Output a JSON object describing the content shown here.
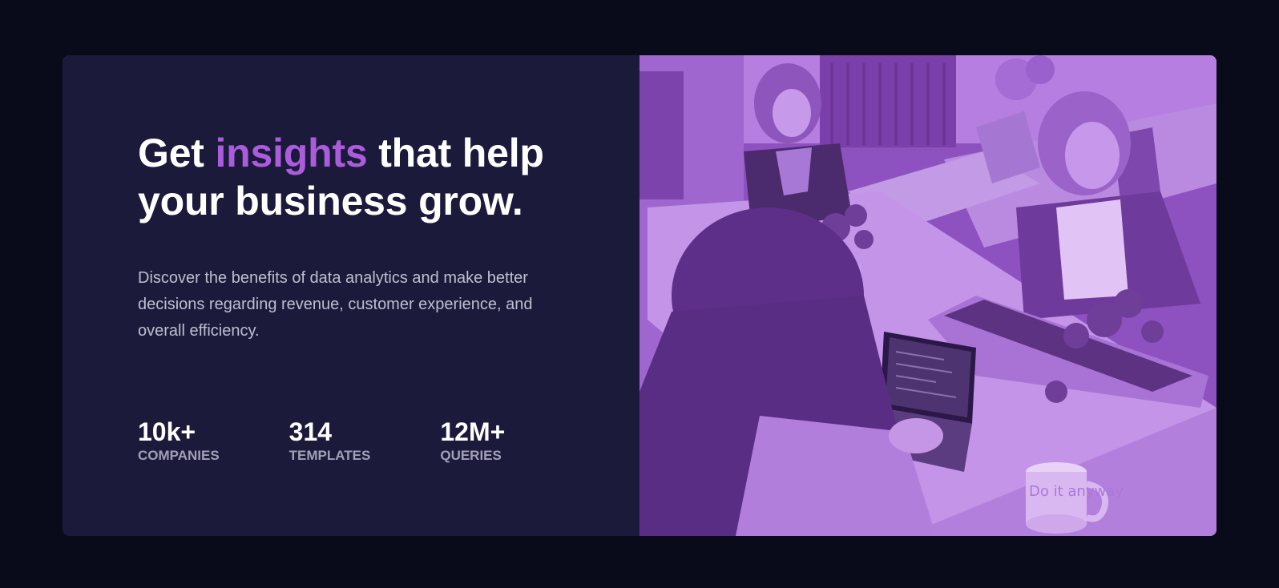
{
  "hero": {
    "headline_start": "Get ",
    "headline_accent": "insights",
    "headline_end": " that help your business grow.",
    "description": "Discover the benefits of data analytics and make better decisions regarding revenue, customer experience, and overall efficiency."
  },
  "stats": [
    {
      "value": "10k+",
      "label": "COMPANIES"
    },
    {
      "value": "314",
      "label": "TEMPLATES"
    },
    {
      "value": "12M+",
      "label": "QUERIES"
    }
  ],
  "image": {
    "mug_text": "Do it anyway"
  },
  "colors": {
    "page_background": "#090b1a",
    "card_background": "#1c1a3b",
    "accent": "#ab5cdb",
    "image_tint": "#8c4fbf"
  }
}
